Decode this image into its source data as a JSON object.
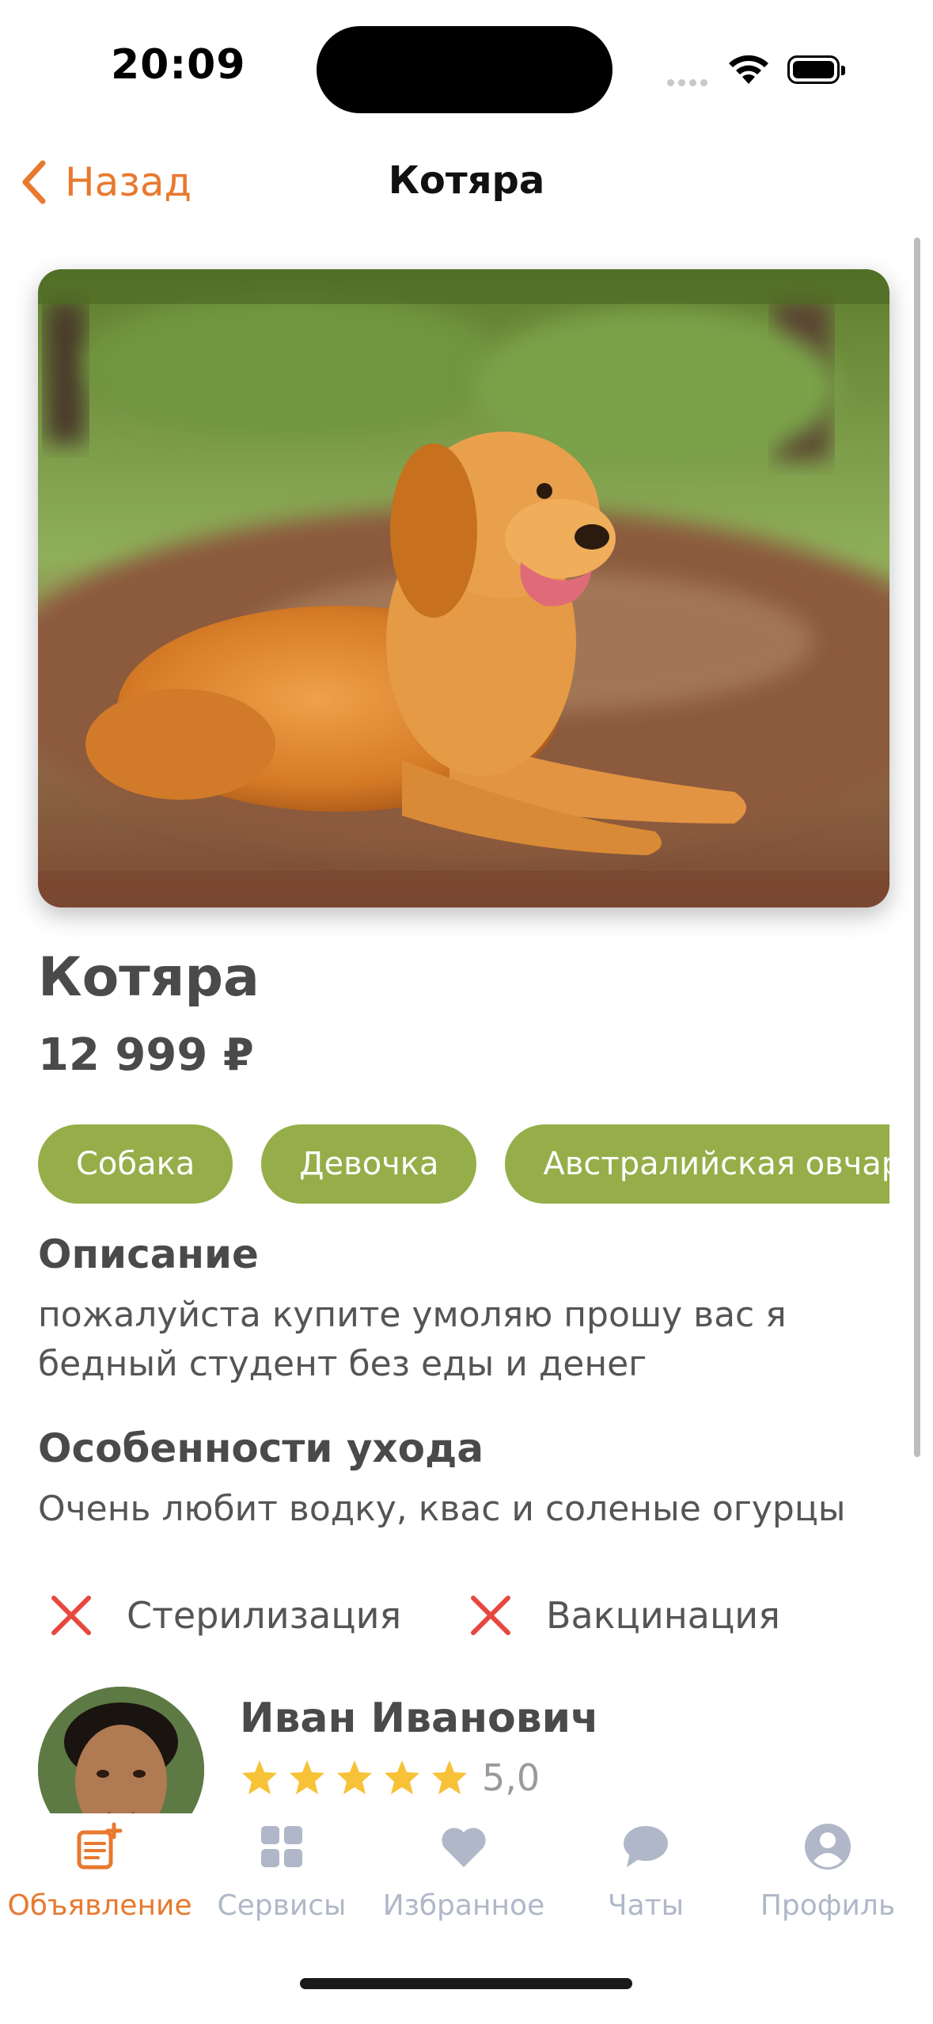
{
  "status": {
    "time": "20:09"
  },
  "nav": {
    "back_label": "Назад",
    "title": "Котяра"
  },
  "listing": {
    "title": "Котяра",
    "price": "12 999 ₽",
    "tags": [
      "Собака",
      "Девочка",
      "Австралийская овчарка"
    ],
    "description_heading": "Описание",
    "description": "пожалуйста купите умоляю прошу вас я бедный студент без еды и денег",
    "care_heading": "Особенности ухода",
    "care": "Очень любит водку, квас и соленые огурцы",
    "flags": [
      {
        "label": "Стерилизация",
        "checked": false
      },
      {
        "label": "Вакцинация",
        "checked": false
      }
    ]
  },
  "seller": {
    "name": "Иван Иванович",
    "rating": "5,0",
    "stars": 5
  },
  "colors": {
    "accent": "#e8792f",
    "tag": "#95ae49",
    "star": "#f7c238",
    "cross": "#e8473f",
    "inactive": "#b0b7c8"
  },
  "tabs": [
    {
      "label": "Объявление",
      "icon": "listing-add-icon",
      "active": true
    },
    {
      "label": "Сервисы",
      "icon": "grid-icon",
      "active": false
    },
    {
      "label": "Избранное",
      "icon": "heart-icon",
      "active": false
    },
    {
      "label": "Чаты",
      "icon": "chat-icon",
      "active": false
    },
    {
      "label": "Профиль",
      "icon": "profile-icon",
      "active": false
    }
  ]
}
